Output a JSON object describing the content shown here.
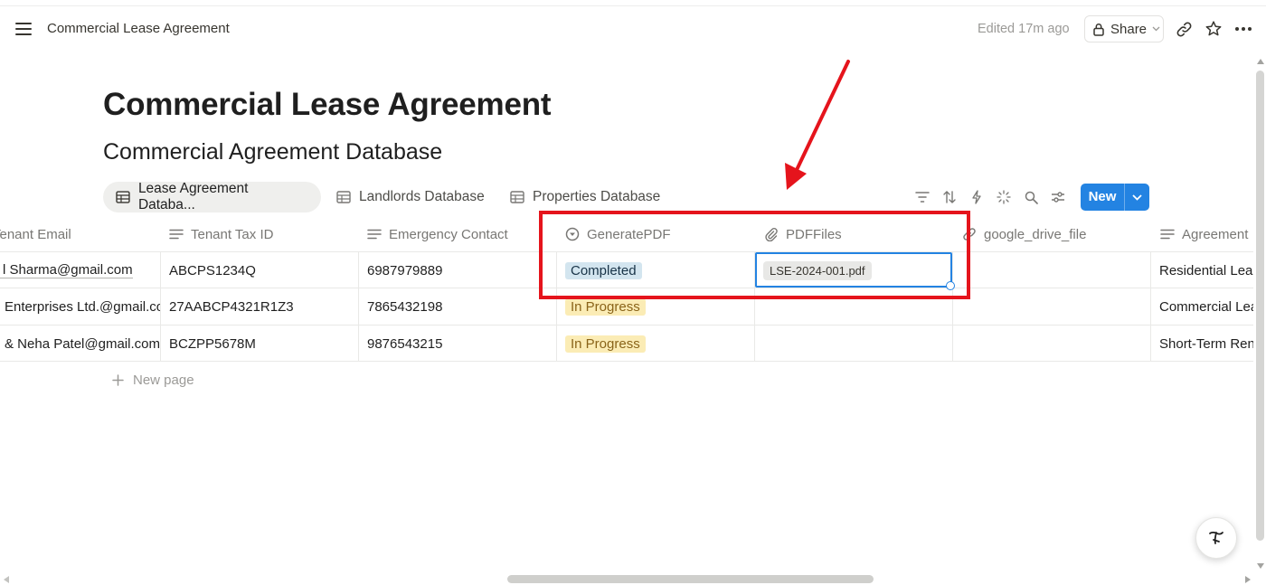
{
  "topbar": {
    "breadcrumb": "Commercial Lease Agreement",
    "edited": "Edited 17m ago",
    "share_label": "Share"
  },
  "page": {
    "title": "Commercial Lease Agreement",
    "subtitle": "Commercial Agreement Database"
  },
  "tabs": [
    {
      "label": "Lease Agreement Databa..."
    },
    {
      "label": "Landlords Database"
    },
    {
      "label": "Properties Database"
    }
  ],
  "new_button": "New",
  "columns": [
    {
      "label": "Tenant Email"
    },
    {
      "label": "Tenant Tax ID"
    },
    {
      "label": "Emergency Contact"
    },
    {
      "label": "GeneratePDF"
    },
    {
      "label": "PDFFiles"
    },
    {
      "label": "google_drive_file"
    },
    {
      "label": "Agreement"
    }
  ],
  "rows": [
    {
      "email": "l Sharma@gmail.com",
      "tax": "ABCPS1234Q",
      "contact": "6987979889",
      "status": "Completed",
      "file": "LSE-2024-001.pdf",
      "agreement": "Residential Leas"
    },
    {
      "email": "Enterprises Ltd.@gmail.co",
      "tax": "27AABCP4321R1Z3",
      "contact": "7865432198",
      "status": "In Progress",
      "file": "",
      "agreement": "Commercial Lea"
    },
    {
      "email": "& Neha Patel@gmail.com",
      "tax": "BCZPP5678M",
      "contact": "9876543215",
      "status": "In Progress",
      "file": "",
      "agreement": "Short-Term Ren"
    }
  ],
  "new_page": "New page",
  "colors": {
    "accent": "#2383e2",
    "annotation_red": "#e5141c"
  }
}
